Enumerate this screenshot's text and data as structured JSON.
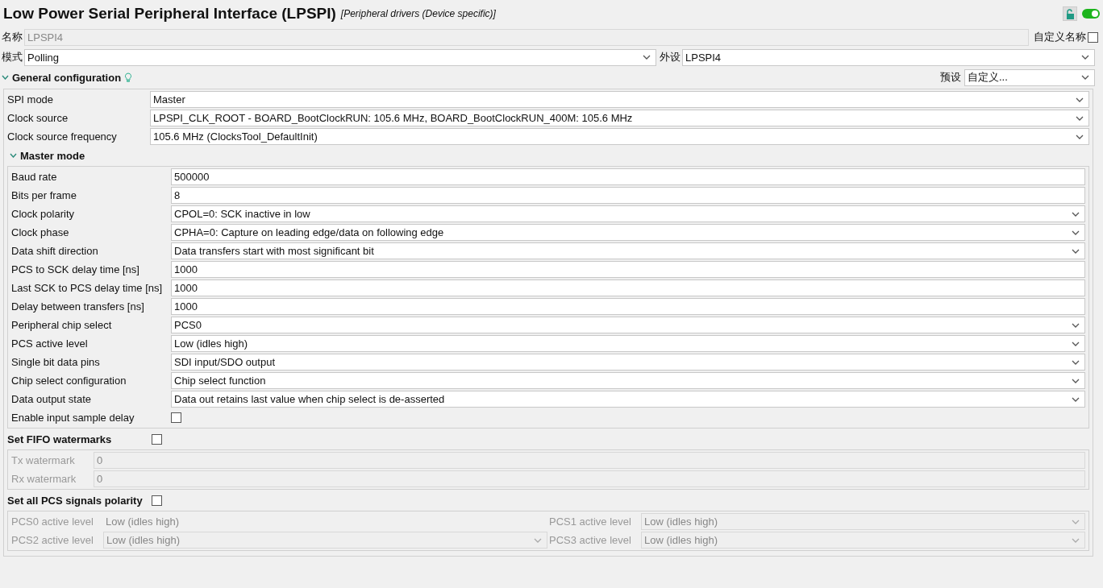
{
  "header": {
    "title": "Low Power Serial Peripheral Interface (LPSPI)",
    "subtitle": "[Peripheral drivers (Device specific)]",
    "locked": false,
    "enabled": true
  },
  "name_row": {
    "label": "名称",
    "value": "LPSPI4",
    "disabled": true,
    "custom_label": "自定义名称",
    "custom_checked": false
  },
  "mode_row": {
    "label": "模式",
    "value": "Polling",
    "peripheral_label": "外设",
    "peripheral_value": "LPSPI4"
  },
  "general": {
    "title": "General configuration",
    "expanded": true,
    "preset_label": "预设",
    "preset_value": "自定义...",
    "fields": [
      {
        "label": "SPI mode",
        "kind": "select",
        "value": "Master"
      },
      {
        "label": "Clock source",
        "kind": "select",
        "value": "LPSPI_CLK_ROOT - BOARD_BootClockRUN: 105.6 MHz, BOARD_BootClockRUN_400M: 105.6 MHz"
      },
      {
        "label": "Clock source frequency",
        "kind": "select",
        "value": "105.6 MHz (ClocksTool_DefaultInit)"
      }
    ]
  },
  "master_mode": {
    "title": "Master mode",
    "expanded": true,
    "fields": [
      {
        "label": "Baud rate",
        "kind": "input",
        "value": "500000"
      },
      {
        "label": "Bits per frame",
        "kind": "input",
        "value": "8"
      },
      {
        "label": "Clock polarity",
        "kind": "select",
        "value": "CPOL=0: SCK inactive in low"
      },
      {
        "label": "Clock phase",
        "kind": "select",
        "value": "CPHA=0: Capture on leading edge/data on following edge"
      },
      {
        "label": "Data shift direction",
        "kind": "select",
        "value": "Data transfers start with most significant bit"
      },
      {
        "label": "PCS to SCK delay time [ns]",
        "kind": "input",
        "value": "1000"
      },
      {
        "label": "Last SCK to PCS delay time [ns]",
        "kind": "input",
        "value": "1000"
      },
      {
        "label": "Delay between transfers [ns]",
        "kind": "input",
        "value": "1000"
      },
      {
        "label": "Peripheral chip select",
        "kind": "select",
        "value": "PCS0"
      },
      {
        "label": "PCS active level",
        "kind": "select",
        "value": "Low (idles high)"
      },
      {
        "label": "Single bit data pins",
        "kind": "select",
        "value": "SDI input/SDO output"
      },
      {
        "label": "Chip select configuration",
        "kind": "select",
        "value": "Chip select function"
      },
      {
        "label": "Data output state",
        "kind": "select",
        "value": "Data out retains last value when chip select is de-asserted"
      },
      {
        "label": "Enable input sample delay",
        "kind": "checkbox",
        "checked": false
      }
    ]
  },
  "fifo": {
    "title": "Set FIFO watermarks",
    "checked": false,
    "fields": [
      {
        "label": "Tx watermark",
        "kind": "input",
        "value": "0",
        "disabled": true
      },
      {
        "label": "Rx watermark",
        "kind": "input",
        "value": "0",
        "disabled": true
      }
    ]
  },
  "pcs_polarity": {
    "title": "Set all PCS signals polarity",
    "checked": false,
    "fields": [
      {
        "label": "PCS0 active level",
        "kind": "text",
        "value": "Low (idles high)",
        "disabled": true
      },
      {
        "label": "PCS1 active level",
        "kind": "select",
        "value": "Low (idles high)",
        "disabled": true
      },
      {
        "label": "PCS2 active level",
        "kind": "select",
        "value": "Low (idles high)",
        "disabled": true
      },
      {
        "label": "PCS3 active level",
        "kind": "select",
        "value": "Low (idles high)",
        "disabled": true
      }
    ]
  }
}
